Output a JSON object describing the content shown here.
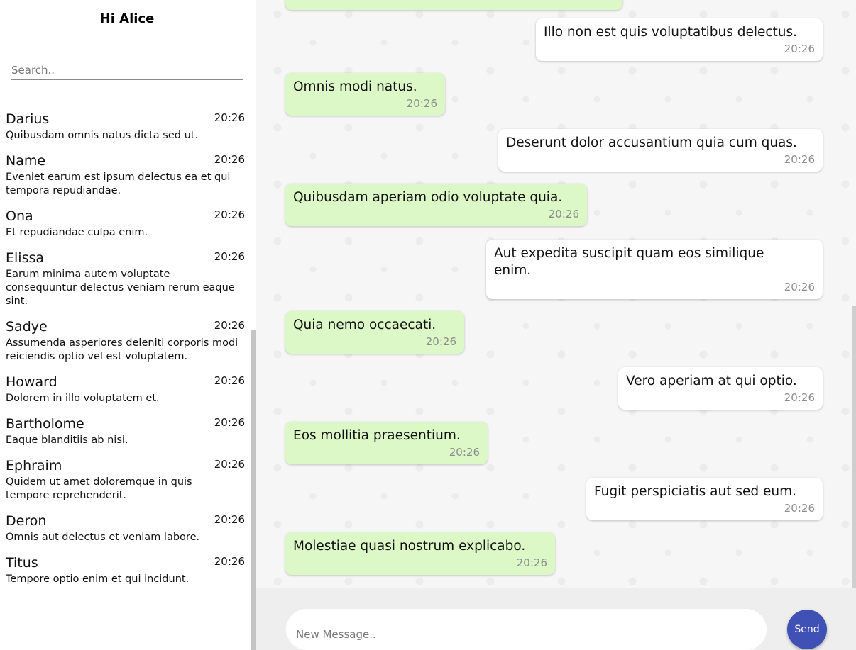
{
  "sidebar": {
    "greeting": "Hi Alice",
    "search_placeholder": "Search..",
    "contacts": [
      {
        "name": "Darius",
        "time": "20:26",
        "preview": "Quibusdam omnis natus dicta sed ut."
      },
      {
        "name": "Name",
        "time": "20:26",
        "preview": "Eveniet earum est ipsum delectus ea et qui tempora repudiandae."
      },
      {
        "name": "Ona",
        "time": "20:26",
        "preview": "Et repudiandae culpa enim."
      },
      {
        "name": "Elissa",
        "time": "20:26",
        "preview": "Earum minima autem voluptate consequuntur delectus veniam rerum eaque sint."
      },
      {
        "name": "Sadye",
        "time": "20:26",
        "preview": "Assumenda asperiores deleniti corporis modi reiciendis optio vel est voluptatem."
      },
      {
        "name": "Howard",
        "time": "20:26",
        "preview": "Dolorem in illo voluptatem et."
      },
      {
        "name": "Bartholome",
        "time": "20:26",
        "preview": "Eaque blanditiis ab nisi."
      },
      {
        "name": "Ephraim",
        "time": "20:26",
        "preview": "Quidem ut amet doloremque in quis tempore reprehenderit."
      },
      {
        "name": "Deron",
        "time": "20:26",
        "preview": "Omnis aut delectus et veniam labore."
      },
      {
        "name": "Titus",
        "time": "20:26",
        "preview": "Tempore optio enim et qui incidunt."
      }
    ]
  },
  "chat": {
    "messages": [
      {
        "text": "Illo non est quis voluptatibus delectus.",
        "time": "20:26",
        "direction": "out"
      },
      {
        "text": "Omnis modi natus.",
        "time": "20:26",
        "direction": "in"
      },
      {
        "text": "Deserunt dolor accusantium quia cum quas.",
        "time": "20:26",
        "direction": "out"
      },
      {
        "text": "Quibusdam aperiam odio voluptate quia.",
        "time": "20:26",
        "direction": "in"
      },
      {
        "text": "Aut expedita suscipit quam eos similique enim.",
        "time": "20:26",
        "direction": "out"
      },
      {
        "text": "Quia nemo occaecati.",
        "time": "20:26",
        "direction": "in"
      },
      {
        "text": "Vero aperiam at qui optio.",
        "time": "20:26",
        "direction": "out"
      },
      {
        "text": "Eos mollitia praesentium.",
        "time": "20:26",
        "direction": "in"
      },
      {
        "text": "Fugit perspiciatis aut sed eum.",
        "time": "20:26",
        "direction": "out"
      },
      {
        "text": "Molestiae quasi nostrum explicabo.",
        "time": "20:26",
        "direction": "in"
      }
    ]
  },
  "composer": {
    "placeholder": "New Message..",
    "send_label": "Send"
  },
  "colors": {
    "incoming_bubble": "#dcf8c6",
    "outgoing_bubble": "#ffffff",
    "send_button": "#3f51b5"
  }
}
